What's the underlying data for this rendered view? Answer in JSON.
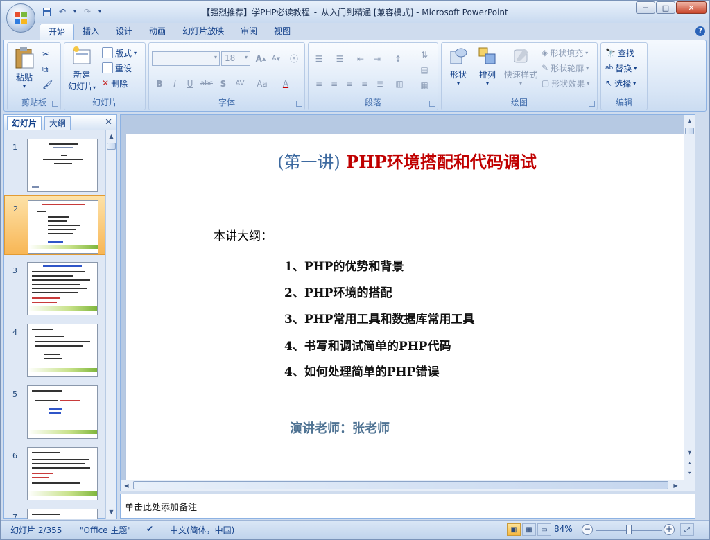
{
  "window": {
    "title": "【强烈推荐】学PHP必读教程_-_从入门到精通 [兼容模式] - Microsoft PowerPoint",
    "controls": {
      "minimize": "─",
      "maximize": "□",
      "close": "✕"
    }
  },
  "qat": {
    "save_icon": "save-icon",
    "undo_glyph": "↶",
    "redo_glyph": "↷",
    "menu_glyph": "▾"
  },
  "ribbon": {
    "tabs": [
      "开始",
      "插入",
      "设计",
      "动画",
      "幻灯片放映",
      "审阅",
      "视图"
    ],
    "active_tab": "开始",
    "help": "?",
    "clipboard": {
      "label": "剪贴板",
      "paste": "粘贴"
    },
    "slides": {
      "label": "幻灯片",
      "new_slide": "新建",
      "new_slide2": "幻灯片",
      "layout": "版式",
      "reset": "重设",
      "delete": "删除"
    },
    "font": {
      "label": "字体",
      "font_name": "",
      "font_size": "18",
      "bold": "B",
      "italic": "I",
      "underline": "U",
      "strike": "abc",
      "shadow": "S",
      "spacing": "AV",
      "case": "Aa",
      "color": "A"
    },
    "paragraph": {
      "label": "段落"
    },
    "drawing": {
      "label": "绘图",
      "shapes": "形状",
      "arrange": "排列",
      "quick_styles": "快速样式",
      "fill": "形状填充",
      "outline": "形状轮廓",
      "effects": "形状效果"
    },
    "editing": {
      "label": "编辑",
      "find": "查找",
      "replace": "替换",
      "select": "选择"
    }
  },
  "left_pane": {
    "tabs": [
      "幻灯片",
      "大纲"
    ],
    "close": "✕",
    "thumbnails": [
      "1",
      "2",
      "3",
      "4",
      "5",
      "6",
      "7"
    ],
    "selected": "2"
  },
  "slide": {
    "title_prefix": "(第一讲)",
    "title_main": "PHP环境搭配和代码调试",
    "outline_heading": "本讲大纲：",
    "items": [
      "1、PHP的优势和背景",
      "2、PHP环境的搭配",
      "3、PHP常用工具和数据库常用工具",
      "4、书写和调试简单的PHP代码",
      "4、如何处理简单的PHP错误"
    ],
    "teacher": "演讲老师：张老师"
  },
  "notes": {
    "placeholder": "单击此处添加备注"
  },
  "status": {
    "slide_count": "幻灯片 2/355",
    "theme": "\"Office 主题\"",
    "language": "中文(简体，中国)",
    "zoom": "84%",
    "zoom_level": 0.5
  },
  "colors": {
    "title_red": "#c00000",
    "title_blue": "#3d6aa0",
    "teacher": "#4f7393",
    "selected_thumb": "#f8b655"
  }
}
